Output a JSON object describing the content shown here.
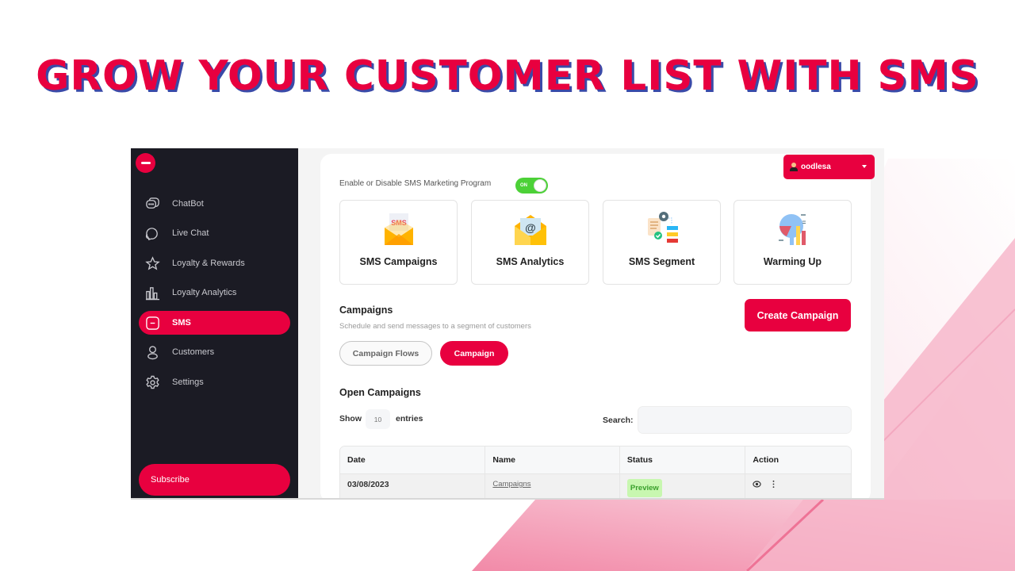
{
  "headline": "GROW YOUR CUSTOMER LIST WITH SMS",
  "colors": {
    "brand": "#e8003f",
    "sidebar_bg": "#1b1b24",
    "toggle_on": "#4cd137",
    "status_preview_bg": "#c8f7b0",
    "status_preview_text": "#3aa02c",
    "headline_shadow": "#3a4aa8"
  },
  "sidebar": {
    "logo_icon": "minus-circle-icon",
    "items": [
      {
        "label": "ChatBot",
        "icon": "chat-bubbles-icon",
        "active": false
      },
      {
        "label": "Live Chat",
        "icon": "live-chat-icon",
        "active": false
      },
      {
        "label": "Loyalty & Rewards",
        "icon": "star-icon",
        "active": false
      },
      {
        "label": "Loyalty Analytics",
        "icon": "bar-chart-icon",
        "active": false
      },
      {
        "label": "SMS",
        "icon": "sms-icon",
        "active": true
      },
      {
        "label": "Customers",
        "icon": "user-icon",
        "active": false
      },
      {
        "label": "Settings",
        "icon": "gear-icon",
        "active": false
      }
    ],
    "subscribe_label": "Subscribe"
  },
  "header": {
    "toggle_label": "Enable or Disable SMS Marketing Program",
    "toggle_state": "ON",
    "user_name": "oodlesa"
  },
  "tiles": [
    {
      "label": "SMS Campaigns",
      "icon": "sms-envelope-icon"
    },
    {
      "label": "SMS Analytics",
      "icon": "email-at-envelope-icon"
    },
    {
      "label": "SMS Segment",
      "icon": "segment-workflow-icon"
    },
    {
      "label": "Warming Up",
      "icon": "pie-bar-chart-icon"
    }
  ],
  "campaigns": {
    "title": "Campaigns",
    "subtitle": "Schedule and send messages to a segment of customers",
    "create_label": "Create Campaign",
    "tabs": [
      {
        "label": "Campaign Flows",
        "active": false
      },
      {
        "label": "Campaign",
        "active": true
      }
    ]
  },
  "open_campaigns": {
    "title": "Open Campaigns",
    "show_label": "Show",
    "entries_value": "10",
    "entries_label": "entries",
    "search_label": "Search:",
    "search_value": "",
    "columns": [
      "Date",
      "Name",
      "Status",
      "Action"
    ],
    "rows": [
      {
        "date": "03/08/2023",
        "name": "Campaigns",
        "status": "Preview",
        "actions": [
          "eye-icon",
          "more-vertical-icon"
        ]
      }
    ]
  }
}
